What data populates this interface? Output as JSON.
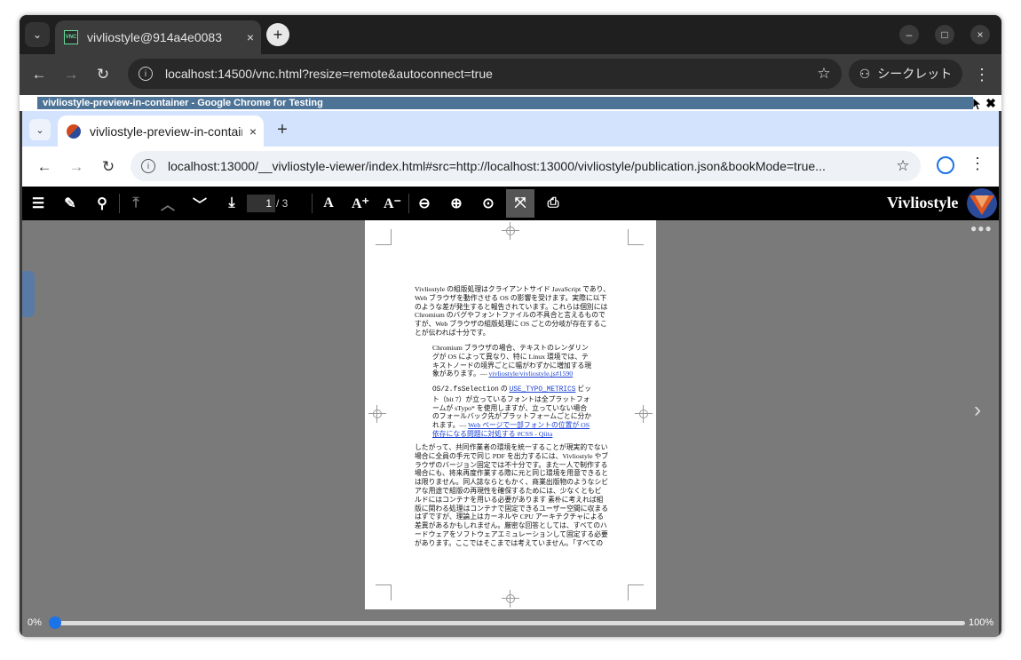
{
  "outer": {
    "tab_title": "vivliostyle@914a4e0083",
    "tab_close": "×",
    "new_tab": "+",
    "url": "localhost:14500/vnc.html?resize=remote&autoconnect=true",
    "incognito_label": "シークレット",
    "vnc_icon_text": "VNC",
    "window_controls": {
      "minimize": "–",
      "maximize": "□",
      "close": "×"
    }
  },
  "vnc": {
    "title": "vivliostyle-preview-in-container - Google Chrome for Testing",
    "close": "✖"
  },
  "inner": {
    "tab_title": "vivliostyle-preview-in-container",
    "tab_close": "×",
    "new_tab": "+",
    "url": "localhost:13000/__vivliostyle-viewer/index.html#src=http://localhost:13000/vivliostyle/publication.json&bookMode=true..."
  },
  "viewer_toolbar": {
    "current_page": "1",
    "total_pages": "/ 3",
    "brand": "Vivliostyle"
  },
  "page_content": {
    "para1": "Vivliostyle の組版処理はクライアントサイド JavaScript であり、\nWeb ブラウザを動作させる OS の影響を受けます。実際に以下\nのような差が発生すると報告されています。これらは個別には\nChromium のバグやフォントファイルの不具合と言えるもので\nすが、Web ブラウザの組版処理に OS ごとの分岐が存在するこ\nとが伝われば十分です。",
    "quote1": "Chromium ブラウザの場合、テキストのレンダリン\nグが OS によって異なり、特に Linux 環境では、テ\nキストノードの境界ごとに幅がわずかに増加する現\n象があります。— ",
    "quote1_link": "vivliostyle/vivliostyle.js#1590",
    "quote2_code1": "OS/2.fsSelection",
    "quote2_mid1": " の ",
    "quote2_code2": "USE_TYPO_METRICS",
    "quote2_rest": " ビッ\nト（bit 7）が立っているフォントは全プラットフォ\nームが sTypo* を使用しますが、立っていない場合\nのフォールバック先がプラットフォームごとに分か\nれます。— ",
    "quote2_link": "Web ページで一部フォントの位置が OS\n依存になる問題に対処する #CSS - Qiita",
    "para2": "したがって、共同作業者の環境を統一することが現実的でない\n場合に全員の手元で同じ PDF を出力するには、Vivliostyle やブ\nラウザのバージョン固定では不十分です。また一人で制作する\n場合にも、将来再度作業する際に元と同じ環境を用意できると\nは限りません。同人誌ならともかく、商業出版物のようなシビ\nアな用途で組版の再現性を確保するためには、少なくともビ\nルドにはコンテナを用いる必要があります 素朴に考えれば組\n版に関わる処理はコンテナで固定できるユーザー空間に収まる\nはずですが、理論上はカーネルや CPU アーキテクチャによる\n差異があるかもしれません。厳密な回答としては、すべてのハ\nードウェアをソフトウェアエミュレーションして固定する必要\nがあります。ここではそこまでは考えていません。「すべての"
  },
  "progress": {
    "min_label": "0%",
    "max_label": "100%",
    "value": 0
  },
  "colors": {
    "accent": "#1a73e8",
    "vnc_title_bg": "#4d7396",
    "viewer_bg": "#7a7a7a",
    "link": "#1a3fd3"
  }
}
